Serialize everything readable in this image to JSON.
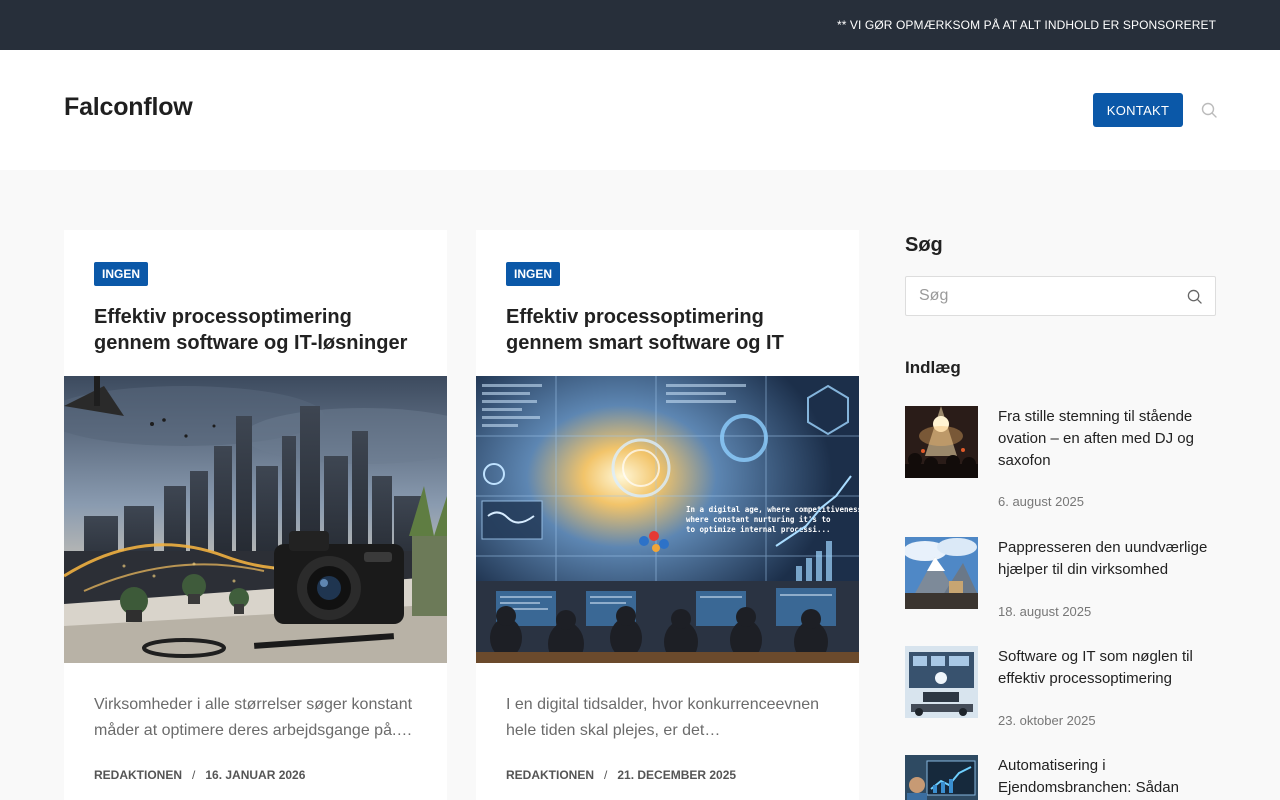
{
  "topbar": {
    "notice": "** VI GØR OPMÆRKSOM PÅ AT ALT INDHOLD ER SPONSORERET"
  },
  "header": {
    "logo": "Falconflow",
    "contact_label": "KONTAKT",
    "search_icon": "search-icon"
  },
  "cards": [
    {
      "category": "INGEN",
      "title": "Effektiv processoptimering gennem software og IT-løsninger",
      "excerpt": "Virksomheder i alle størrelser søger konstant måder at optimere deres arbejdsgange på.…",
      "author": "REDAKTIONEN",
      "date": "16. JANUAR 2026"
    },
    {
      "category": "INGEN",
      "title": "Effektiv processoptimering gennem smart software og IT",
      "excerpt": "I en digital tidsalder, hvor konkurrenceevnen hele tiden skal plejes, er det…",
      "author": "REDAKTIONEN",
      "date": "21. DECEMBER 2025",
      "image_text_line1": "In a digital age, where competitiveness",
      "image_text_line2": "where constant nurturing it's to",
      "image_text_line3": "to optimize internal processi..."
    }
  ],
  "sidebar": {
    "search_heading": "Søg",
    "search_placeholder": "Søg",
    "posts_heading": "Indlæg",
    "posts": [
      {
        "title": "Fra stille stemning til stående ovation – en aften med DJ og saxofon",
        "date": "6. august 2025"
      },
      {
        "title": "Pappresseren den uundværlige hjælper til din virksomhed",
        "date": "18. august 2025"
      },
      {
        "title": "Software og IT som nøglen til effektiv processoptimering",
        "date": "23. oktober 2025"
      },
      {
        "title": "Automatisering i Ejendomsbranchen: Sådan",
        "date": ""
      }
    ]
  },
  "colors": {
    "accent": "#0b58a8",
    "topbar": "#272f3a",
    "page_bg": "#f9f9f9"
  }
}
